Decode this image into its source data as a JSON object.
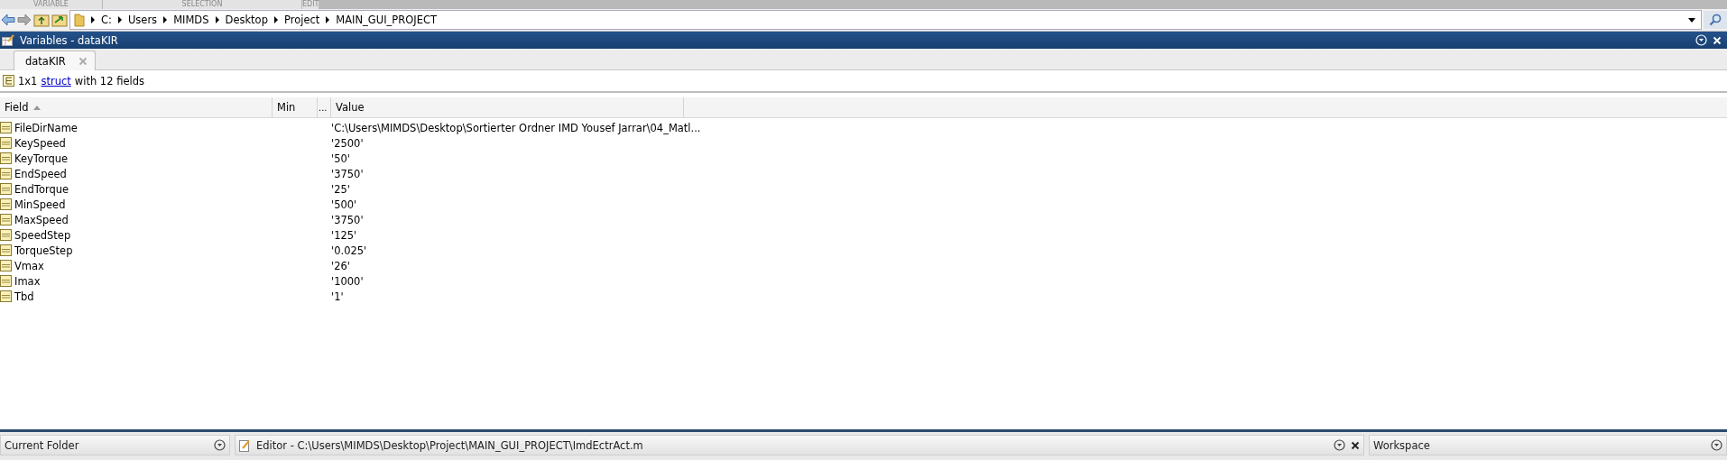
{
  "ribbon_sections": [
    "VARIABLE",
    "SELECTION",
    "EDIT"
  ],
  "address_bar": {
    "path": [
      {
        "label": "C:"
      },
      {
        "label": "Users"
      },
      {
        "label": "MIMDS"
      },
      {
        "label": "Desktop"
      },
      {
        "label": "Project"
      },
      {
        "label": "MAIN_GUI_PROJECT"
      }
    ]
  },
  "variables_panel": {
    "title": "Variables - dataKIR",
    "tabs": [
      {
        "label": "dataKIR",
        "selected": true
      }
    ],
    "summary": {
      "prefix": "1x1",
      "link": "struct",
      "suffix": "with 12 fields"
    },
    "table": {
      "columns": [
        {
          "label": "Field",
          "sorted": true
        },
        {
          "label": "Min"
        },
        {
          "label": "..."
        },
        {
          "label": "Value"
        }
      ],
      "rows": [
        {
          "field": "FileDirName",
          "value": "'C:\\Users\\MIMDS\\Desktop\\Sortierter Ordner IMD Yousef Jarrar\\04_Matl..."
        },
        {
          "field": "KeySpeed",
          "value": "'2500'"
        },
        {
          "field": "KeyTorque",
          "value": "'50'"
        },
        {
          "field": "EndSpeed",
          "value": "'3750'"
        },
        {
          "field": "EndTorque",
          "value": "'25'"
        },
        {
          "field": "MinSpeed",
          "value": "'500'"
        },
        {
          "field": "MaxSpeed",
          "value": "'3750'"
        },
        {
          "field": "SpeedStep",
          "value": "'125'"
        },
        {
          "field": "TorqueStep",
          "value": "'0.025'"
        },
        {
          "field": "Vmax",
          "value": "'26'"
        },
        {
          "field": "Imax",
          "value": "'1000'"
        },
        {
          "field": "Tbd",
          "value": "'1'"
        }
      ]
    }
  },
  "bottom_panels": [
    {
      "title": "Current Folder",
      "closable": false
    },
    {
      "title": "Editor - C:\\Users\\MIMDS\\Desktop\\Project\\MAIN_GUI_PROJECT\\ImdEctrAct.m",
      "closable": true
    },
    {
      "title": "Workspace",
      "closable": false
    }
  ]
}
